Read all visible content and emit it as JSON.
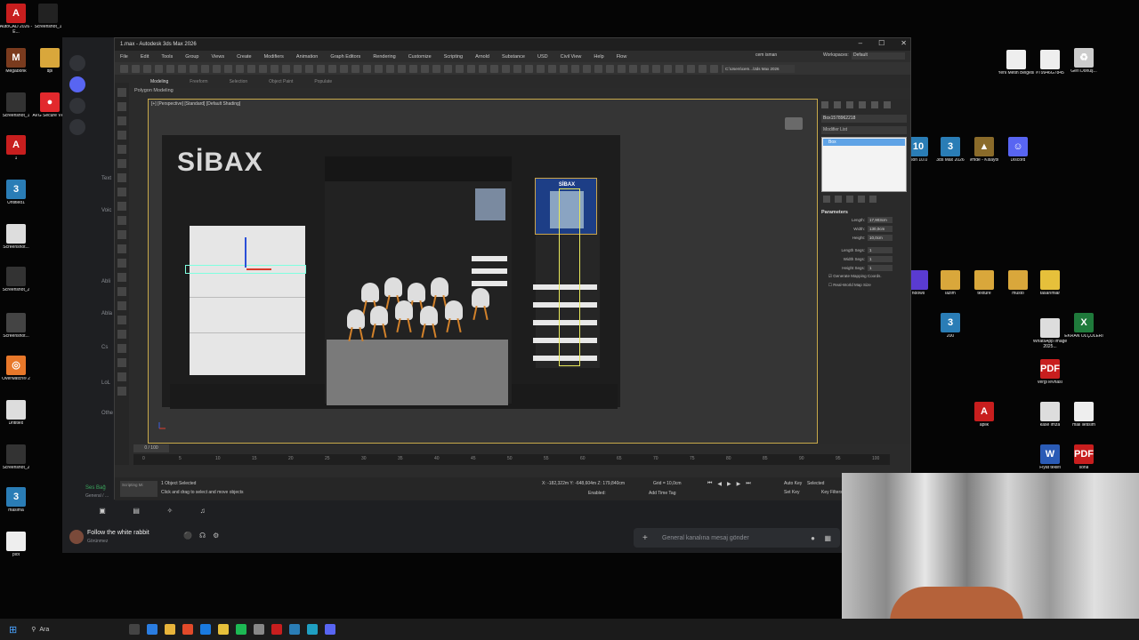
{
  "desktop_left": [
    {
      "label": "AutoCAD 2026 - E...",
      "color": "#c81e1e",
      "glyph": "A"
    },
    {
      "label": "Screenshot_1",
      "color": "#222",
      "glyph": ""
    },
    {
      "label": "Megabonk",
      "color": "#7a3b1e",
      "glyph": "M"
    },
    {
      "label": "dpi",
      "color": "#d9a73b",
      "glyph": ""
    },
    {
      "label": "Screenshot_1",
      "color": "#333",
      "glyph": ""
    },
    {
      "label": "AVG Secure VPN",
      "color": "#e2292d",
      "glyph": "●"
    },
    {
      "label": "1",
      "color": "#c81e1e",
      "glyph": "A"
    },
    {
      "label": "Untitled1",
      "color": "#2a7db6",
      "glyph": "3"
    },
    {
      "label": "Screenshot...",
      "color": "#ddd",
      "glyph": ""
    },
    {
      "label": "Screenshot_2",
      "color": "#333",
      "glyph": ""
    },
    {
      "label": "Screenshot...",
      "color": "#444",
      "glyph": ""
    },
    {
      "label": "Overwatch® 2",
      "color": "#e8782a",
      "glyph": "◎"
    },
    {
      "label": "Untitled",
      "color": "#ddd",
      "glyph": ""
    },
    {
      "label": "Screenshot_2",
      "color": "#333",
      "glyph": ""
    },
    {
      "label": "masima",
      "color": "#2a7db6",
      "glyph": "3"
    },
    {
      "label": "plot",
      "color": "#eee",
      "glyph": ""
    }
  ],
  "desktop_right": [
    {
      "label": "Yeni Metin Belgesi",
      "color": "#eee",
      "glyph": ""
    },
    {
      "label": "#79946G7845",
      "color": "#eee",
      "glyph": ""
    },
    {
      "label": "Geri Dönüş...",
      "color": "#ccc",
      "glyph": "♻"
    },
    {
      "label": "sion 10.0",
      "color": "#2a7db6",
      "glyph": "10"
    },
    {
      "label": "3ds Max 2026",
      "color": "#2a7db6",
      "glyph": "3"
    },
    {
      "label": "vmde - Kisayol",
      "color": "#8a6b2a",
      "glyph": "▲"
    },
    {
      "label": "Discord",
      "color": "#5865f2",
      "glyph": "☺"
    },
    {
      "label": "ndows",
      "color": "#5a3bd0",
      "glyph": ""
    },
    {
      "label": "lazim",
      "color": "#d9a73b",
      "glyph": ""
    },
    {
      "label": "texture",
      "color": "#d9a73b",
      "glyph": ""
    },
    {
      "label": "müsto",
      "color": "#d9a73b",
      "glyph": ""
    },
    {
      "label": "tasarımlar",
      "color": "#e6c03b",
      "glyph": ""
    },
    {
      "label": "200",
      "color": "#2a7db6",
      "glyph": "3"
    },
    {
      "label": "WhatsApp Image 2025...",
      "color": "#ddd",
      "glyph": ""
    },
    {
      "label": "EKRAN ÖLÇÜLERİ",
      "color": "#1f7a3b",
      "glyph": "X"
    },
    {
      "label": "vergi levhası",
      "color": "#c81e1e",
      "glyph": "PDF"
    },
    {
      "label": "aplik",
      "color": "#c81e1e",
      "glyph": "A"
    },
    {
      "label": "kase imza",
      "color": "#ddd",
      "glyph": ""
    },
    {
      "label": "mail iletisim",
      "color": "#eee",
      "glyph": ""
    },
    {
      "label": "Fiyat teklifi",
      "color": "#2a5bb6",
      "glyph": "W"
    },
    {
      "label": "sona",
      "color": "#c81e1e",
      "glyph": "PDF"
    }
  ],
  "max": {
    "title": "1.max - Autodesk 3ds Max 2026",
    "menus": [
      "File",
      "Edit",
      "Tools",
      "Group",
      "Views",
      "Create",
      "Modifiers",
      "Animation",
      "Graph Editors",
      "Rendering",
      "Customize",
      "Scripting",
      "Arnold",
      "Substance",
      "USD",
      "Civil View",
      "Help",
      "Flow"
    ],
    "user": "cem isman",
    "workspaces_label": "Workspaces:",
    "workspace": "Default",
    "path": "C:\\Users\\cem...\\3ds Max 2026",
    "ribbon_tabs": [
      "Modeling",
      "Freeform",
      "Selection",
      "Object Paint",
      "Populate"
    ],
    "ribbon_sub": "Polygon Modeling",
    "viewport_label": "[+] [Perspective] [Standard] [Default Shading]",
    "scene_logo": "SİBAX",
    "poster_text": "SİBAX"
  },
  "cmd": {
    "object_name": "Box1578962218",
    "modifier_list": "Modifier List",
    "stack_item": "Box",
    "params_title": "Parameters",
    "params": [
      {
        "label": "Length:",
        "value": "17,903cm"
      },
      {
        "label": "Width:",
        "value": "130,0cm"
      },
      {
        "label": "Height:",
        "value": "10,0cm"
      }
    ],
    "segs": [
      {
        "label": "Length Segs:",
        "value": "1"
      },
      {
        "label": "Width Segs:",
        "value": "1"
      },
      {
        "label": "Height Segs:",
        "value": "1"
      }
    ],
    "gen_mapping": "Generate Mapping Coords.",
    "real_world": "Real-World Map Size"
  },
  "timeline": {
    "slider": "0 / 100",
    "ticks": [
      "0",
      "5",
      "10",
      "15",
      "20",
      "25",
      "30",
      "35",
      "40",
      "45",
      "50",
      "55",
      "60",
      "65",
      "70",
      "75",
      "80",
      "85",
      "90",
      "95",
      "100"
    ]
  },
  "status": {
    "selected": "1 Object Selected",
    "hint": "Click and drag to select and move objects",
    "x": "X: -182,322m",
    "y": "Y: -648,604m",
    "z": "Z: 179,840cm",
    "grid": "Grid = 10,0cm",
    "enabled": "Enabled:",
    "add_time_tag": "Add Time Tag",
    "auto_key": "Auto Key",
    "set_key": "Set Key",
    "selected_dd": "Selected",
    "key_filters": "Key Filters...",
    "maxscript": "Scripting Mi"
  },
  "discord": {
    "user_name": "Follow the white rabbit",
    "user_status": "Görünmez",
    "message_placeholder": "General kanalına mesaj gönder",
    "voice_label": "Ses Bağ",
    "voice_sub": "General / ...",
    "channel_items": [
      "Text",
      "Voic",
      "Abli",
      "Abla",
      "Cs",
      "LoL",
      "Othe"
    ]
  },
  "taskbar": {
    "search": "Ara"
  }
}
